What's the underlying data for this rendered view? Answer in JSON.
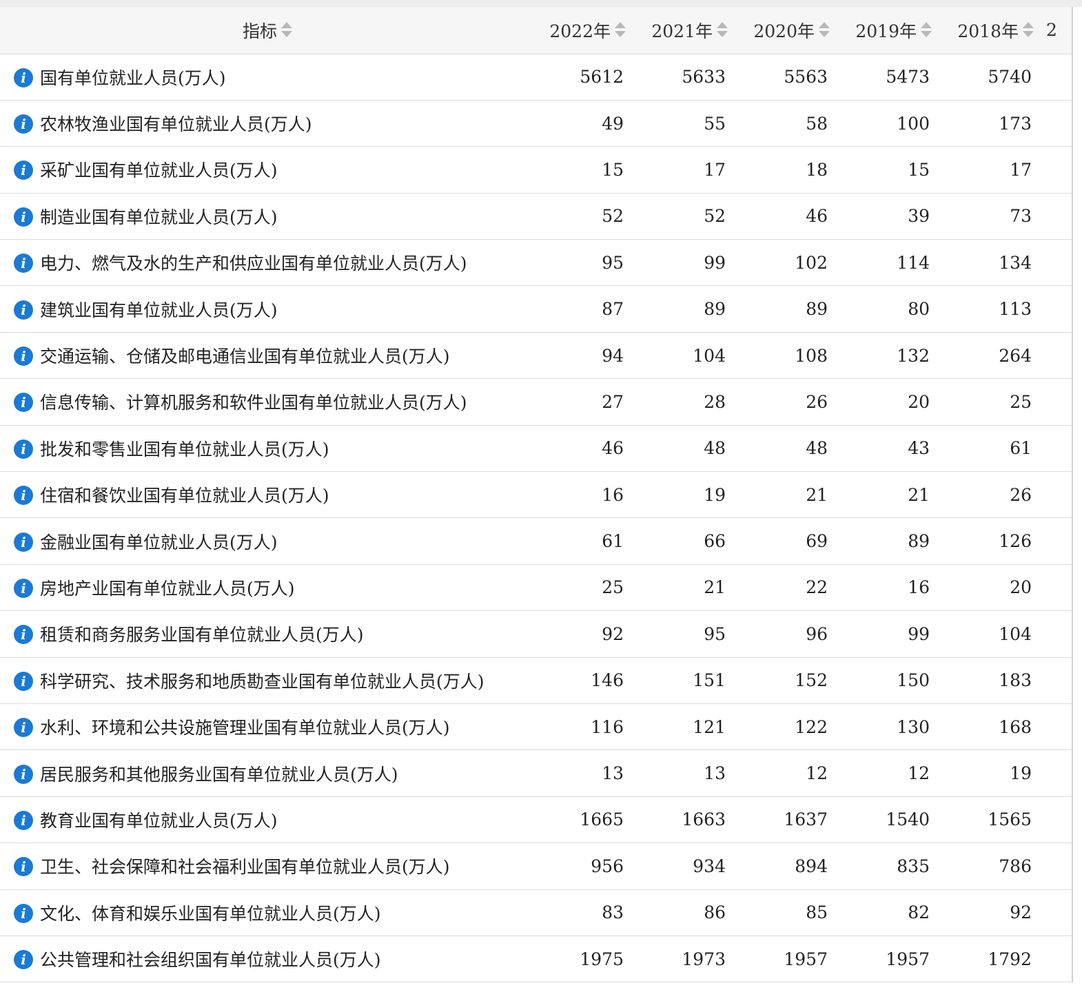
{
  "header": {
    "indicator_label": "指标",
    "years": [
      "2022年",
      "2021年",
      "2020年",
      "2019年",
      "2018年"
    ],
    "cut_year": "2"
  },
  "icons": {
    "row_icon": "info-icon",
    "sort_icon": "sort-icon",
    "info_color": "#1a7ad6"
  },
  "rows": [
    {
      "label": "国有单位就业人员(万人)",
      "values": [
        "5612",
        "5633",
        "5563",
        "5473",
        "5740"
      ]
    },
    {
      "label": "农林牧渔业国有单位就业人员(万人)",
      "values": [
        "49",
        "55",
        "58",
        "100",
        "173"
      ]
    },
    {
      "label": "采矿业国有单位就业人员(万人)",
      "values": [
        "15",
        "17",
        "18",
        "15",
        "17"
      ]
    },
    {
      "label": "制造业国有单位就业人员(万人)",
      "values": [
        "52",
        "52",
        "46",
        "39",
        "73"
      ]
    },
    {
      "label": "电力、燃气及水的生产和供应业国有单位就业人员(万人)",
      "values": [
        "95",
        "99",
        "102",
        "114",
        "134"
      ]
    },
    {
      "label": "建筑业国有单位就业人员(万人)",
      "values": [
        "87",
        "89",
        "89",
        "80",
        "113"
      ]
    },
    {
      "label": "交通运输、仓储及邮电通信业国有单位就业人员(万人)",
      "values": [
        "94",
        "104",
        "108",
        "132",
        "264"
      ]
    },
    {
      "label": "信息传输、计算机服务和软件业国有单位就业人员(万人)",
      "values": [
        "27",
        "28",
        "26",
        "20",
        "25"
      ]
    },
    {
      "label": "批发和零售业国有单位就业人员(万人)",
      "values": [
        "46",
        "48",
        "48",
        "43",
        "61"
      ]
    },
    {
      "label": "住宿和餐饮业国有单位就业人员(万人)",
      "values": [
        "16",
        "19",
        "21",
        "21",
        "26"
      ]
    },
    {
      "label": "金融业国有单位就业人员(万人)",
      "values": [
        "61",
        "66",
        "69",
        "89",
        "126"
      ]
    },
    {
      "label": "房地产业国有单位就业人员(万人)",
      "values": [
        "25",
        "21",
        "22",
        "16",
        "20"
      ]
    },
    {
      "label": "租赁和商务服务业国有单位就业人员(万人)",
      "values": [
        "92",
        "95",
        "96",
        "99",
        "104"
      ]
    },
    {
      "label": "科学研究、技术服务和地质勘查业国有单位就业人员(万人)",
      "values": [
        "146",
        "151",
        "152",
        "150",
        "183"
      ]
    },
    {
      "label": "水利、环境和公共设施管理业国有单位就业人员(万人)",
      "values": [
        "116",
        "121",
        "122",
        "130",
        "168"
      ]
    },
    {
      "label": "居民服务和其他服务业国有单位就业人员(万人)",
      "values": [
        "13",
        "13",
        "12",
        "12",
        "19"
      ]
    },
    {
      "label": "教育业国有单位就业人员(万人)",
      "values": [
        "1665",
        "1663",
        "1637",
        "1540",
        "1565"
      ]
    },
    {
      "label": "卫生、社会保障和社会福利业国有单位就业人员(万人)",
      "values": [
        "956",
        "934",
        "894",
        "835",
        "786"
      ]
    },
    {
      "label": "文化、体育和娱乐业国有单位就业人员(万人)",
      "values": [
        "83",
        "86",
        "85",
        "82",
        "92"
      ]
    },
    {
      "label": "公共管理和社会组织国有单位就业人员(万人)",
      "values": [
        "1975",
        "1973",
        "1957",
        "1957",
        "1792"
      ]
    }
  ]
}
